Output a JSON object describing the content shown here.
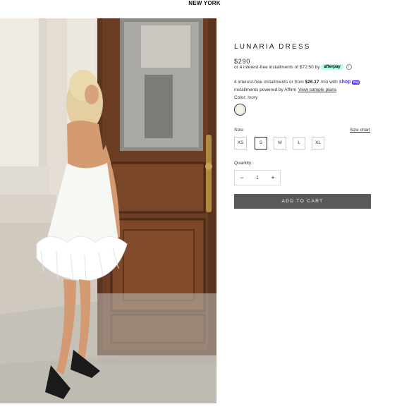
{
  "header": {
    "brand": "NEW YORK"
  },
  "product": {
    "image_icon": "product-photo",
    "title": "LUNARIA DRESS",
    "price": "$290",
    "afterpay": {
      "text": "or 4 interest-free installments of $72.50 by",
      "badge": "afterpay",
      "info_icon": "ⓘ"
    },
    "shop_pay": {
      "text_prefix": "4 interest-free installments or from",
      "amount": "$26.17",
      "text_mid": "/mo with",
      "logo": "shop",
      "badge": "Pay",
      "line2": "installments powered by Affirm",
      "link": "View sample plans"
    },
    "color": {
      "label": "Color: Ivory",
      "swatch_hex": "#f5f2e8"
    },
    "size": {
      "label": "Size:",
      "chart_link": "Size chart",
      "options": [
        "XS",
        "S",
        "M",
        "L",
        "XL"
      ],
      "selected": "S"
    },
    "quantity": {
      "label": "Quantity:",
      "minus": "−",
      "value": "1",
      "plus": "+"
    },
    "add_to_cart": "ADD TO CART"
  },
  "colors": {
    "button_bg": "#595959",
    "afterpay_badge": "#b2fce4",
    "shop_pay": "#5a31f4"
  }
}
